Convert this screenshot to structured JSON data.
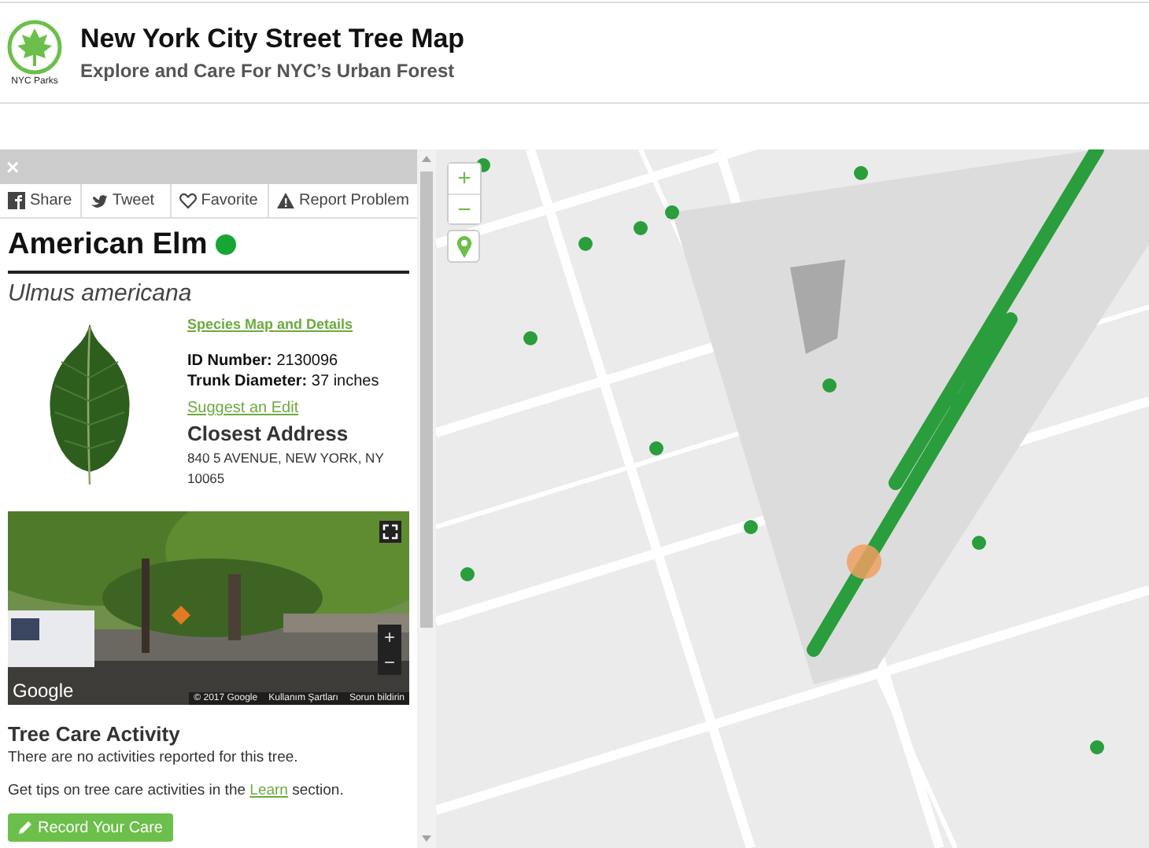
{
  "header": {
    "logo_caption": "NYC Parks",
    "title": "New York City Street Tree Map",
    "subtitle": "Explore and Care For NYC’s Urban Forest"
  },
  "panel": {
    "close_label": "×",
    "actions": [
      {
        "kind": "facebook",
        "label": "Share"
      },
      {
        "kind": "twitter",
        "label": "Tweet"
      },
      {
        "kind": "heart",
        "label": "Favorite"
      },
      {
        "kind": "warning",
        "label": "Report Problem"
      }
    ],
    "species": {
      "common_name": "American Elm",
      "color": "#17a534",
      "scientific_name": "Ulmus americana"
    },
    "leaf_image": {
      "kind": "picture"
    },
    "species_link": "Species Map and Details",
    "fields": [
      {
        "label": "ID Number:",
        "value": "2130096"
      },
      {
        "label": "Trunk Diameter:",
        "value": "37 inches"
      }
    ],
    "edit_link": "Suggest an Edit",
    "address_heading": "Closest Address",
    "address_lines": [
      "840 5 AVENUE, NEW YORK, NY",
      "10065"
    ],
    "street_view": {
      "kind": "picture",
      "logo": "Google",
      "zoom_in": "+",
      "zoom_out": "−",
      "attribution": [
        "© 2017 Google",
        "Kullanım Şartları",
        "Sorun bildirin"
      ]
    },
    "care_heading": "Tree Care Activity",
    "care_empty": "There are no activities reported for this tree.",
    "care_tip": {
      "before": "Get tips on tree care activities in the ",
      "link": "Learn",
      "after": " section."
    },
    "record_button": "Record Your Care"
  },
  "map": {
    "kind": "picture",
    "zoom_in": "+",
    "zoom_out": "−"
  }
}
